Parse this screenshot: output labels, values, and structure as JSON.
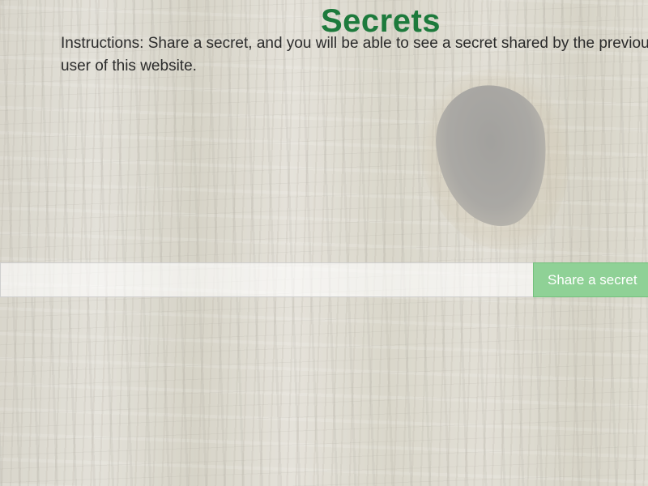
{
  "page": {
    "title": "Secrets",
    "instructions": "Instructions: Share a secret, and you will be able to see a secret shared by the previous user of this website."
  },
  "form": {
    "input_value": "",
    "input_placeholder": "",
    "button_label": "Share a secret"
  },
  "colors": {
    "title": "#1d7a3c",
    "button_bg": "#8fd196",
    "button_text": "#ffffff"
  }
}
